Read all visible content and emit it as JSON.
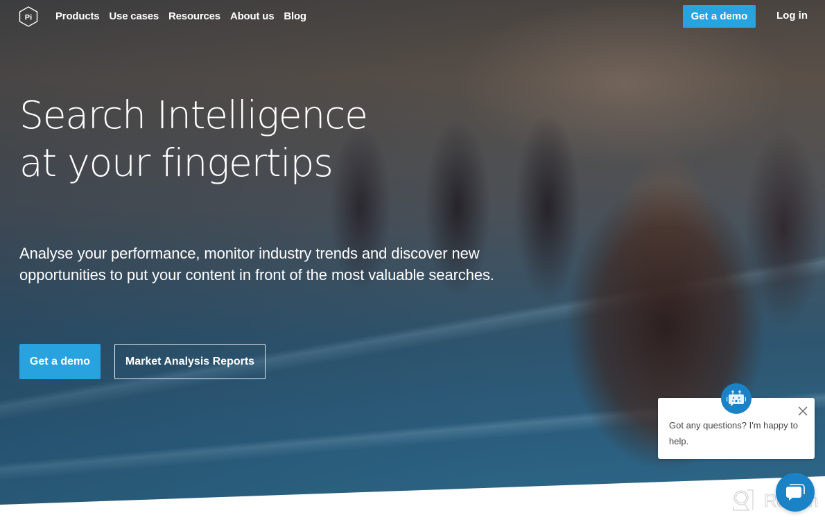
{
  "nav": {
    "logo_text": "Pi",
    "links": [
      {
        "label": "Products"
      },
      {
        "label": "Use cases"
      },
      {
        "label": "Resources"
      },
      {
        "label": "About us"
      },
      {
        "label": "Blog"
      }
    ],
    "cta_label": "Get a demo",
    "login_label": "Log in"
  },
  "hero": {
    "headline_line1": "Search Intelligence",
    "headline_line2": "at your fingertips",
    "sub_line1": "Analyse your performance, monitor industry trends and discover new",
    "sub_line2": "opportunities to put your content in front of the most valuable searches.",
    "primary_cta": "Get a demo",
    "secondary_cta": "Market Analysis Reports"
  },
  "chat": {
    "message": "Got any questions? I'm happy to help.",
    "bot_icon": "robot-icon",
    "close_icon": "close-icon",
    "launcher_icon": "chat-bubble-icon"
  },
  "watermark": {
    "text": "Revain"
  },
  "colors": {
    "accent": "#29a3e0",
    "chat_blue": "#1b82c6",
    "white": "#ffffff"
  }
}
